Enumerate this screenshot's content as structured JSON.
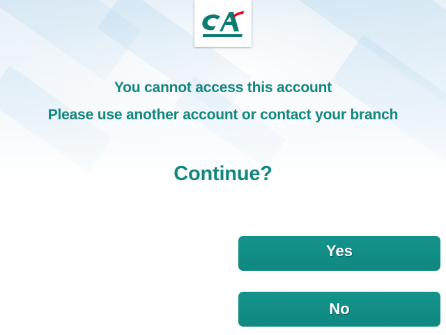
{
  "logo": {
    "text": "CA",
    "colors": {
      "primary": "#0b7c6f",
      "accent": "#e2001a"
    }
  },
  "message": {
    "line1": "You cannot access this account",
    "line2": "Please use another account or contact your branch"
  },
  "question": "Continue?",
  "buttons": {
    "yes": "Yes",
    "no": "No"
  },
  "colors": {
    "text": "#12867f",
    "button_bg": "#12908a",
    "button_text": "#ffffff"
  }
}
